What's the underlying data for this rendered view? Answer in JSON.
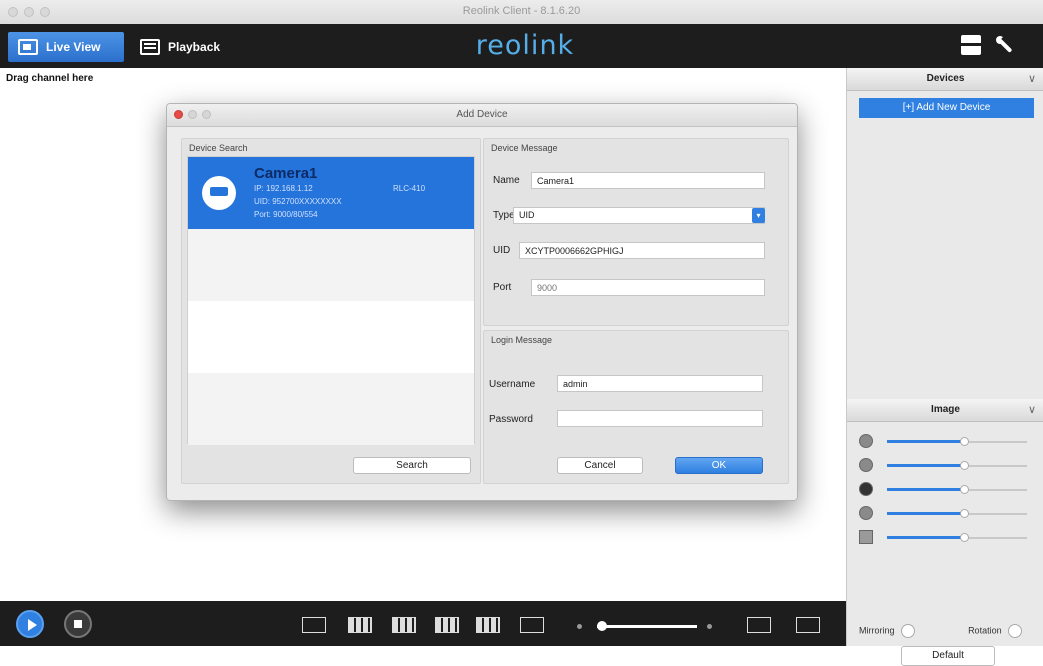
{
  "window": {
    "title": "Reolink Client - 8.1.6.20"
  },
  "toolbar": {
    "live_view": "Live View",
    "playback": "Playback",
    "logo": "reolink"
  },
  "main": {
    "drag_hint": "Drag channel here"
  },
  "right_panel": {
    "devices_header": "Devices",
    "add_new_device": "Add New Device",
    "image_header": "Image",
    "image_sliders": [
      0.55,
      0.55,
      0.55,
      0.55,
      0.55
    ],
    "mirroring": "Mirroring",
    "rotation": "Rotation",
    "default_button": "Default"
  },
  "dialog": {
    "title": "Add Device",
    "device_search_label": "Device Search",
    "device_message_label": "Device Message",
    "login_message_label": "Login Message",
    "search_results": [
      {
        "name": "Camera1",
        "ip": "IP: 192.168.1.12",
        "model": "RLC-410",
        "uid": "UID: 952700XXXXXXXX",
        "port": "Port: 9000/80/554"
      }
    ],
    "fields": {
      "name_label": "Name",
      "name_value": "Camera1",
      "type_label": "Type",
      "type_value": "UID",
      "uid_label": "UID",
      "uid_value": "XCYTP0006662GPHIGJ",
      "port_label": "Port",
      "port_placeholder": "9000",
      "username_label": "Username",
      "username_value": "admin",
      "password_label": "Password",
      "password_value": ""
    },
    "search_button": "Search",
    "cancel_button": "Cancel",
    "ok_button": "OK"
  },
  "bottom_bar": {
    "volume": 0.05
  },
  "colors": {
    "accent": "#2f80e0",
    "toolbar": "#1d1d1d",
    "logo": "#55aee8"
  }
}
